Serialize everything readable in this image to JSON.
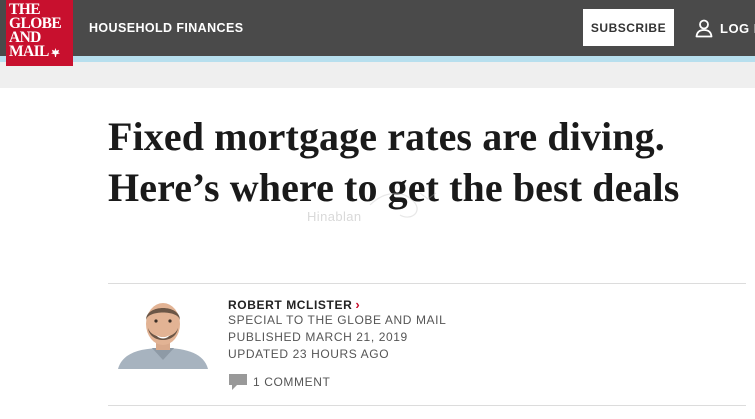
{
  "header": {
    "logo_lines": [
      "THE",
      "GLOBE",
      "AND",
      "MAIL"
    ],
    "section_link": "HOUSEHOLD FINANCES",
    "subscribe_label": "SUBSCRIBE",
    "login_label": "LOG I"
  },
  "article": {
    "headline": "Fixed mortgage rates are diving. Here’s where to get the best deals",
    "author_name": "ROBERT MCLISTER",
    "author_role": "SPECIAL TO THE GLOBE AND MAIL",
    "published": "PUBLISHED MARCH 21, 2019",
    "updated": "UPDATED 23 HOURS AGO",
    "comments": "1 COMMENT"
  },
  "watermark": "Hinablan",
  "colors": {
    "brand_red": "#c8102e",
    "topbar": "#4a4a4a",
    "accent_bar": "#b7dfee"
  },
  "icons": {
    "login": "user-icon",
    "comments": "comment-bubble-icon",
    "author_link": "chevron-right-icon",
    "logo": "maple-leaf-icon"
  }
}
